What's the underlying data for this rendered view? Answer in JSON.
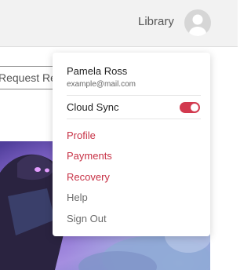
{
  "header": {
    "library_label": "Library"
  },
  "request_button": {
    "label": "Request Rec"
  },
  "user_menu": {
    "name": "Pamela Ross",
    "email": "example@mail.com",
    "cloud_sync": {
      "label": "Cloud Sync",
      "enabled": true
    },
    "items": [
      {
        "label": "Profile"
      },
      {
        "label": "Payments"
      },
      {
        "label": "Recovery"
      },
      {
        "label": "Help"
      },
      {
        "label": "Sign Out"
      }
    ]
  },
  "colors": {
    "accent": "#c73246",
    "toggle_on": "#d23a4f",
    "muted_text": "#6b6b6b",
    "header_bg": "#f2f2f2"
  },
  "icons": {
    "avatar": "user-avatar-icon"
  }
}
